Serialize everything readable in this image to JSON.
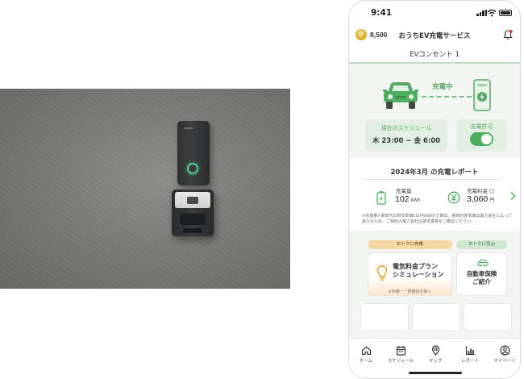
{
  "phone": {
    "status_bar": {
      "time": "9:41"
    },
    "header": {
      "coin_symbol": "P",
      "points": "8,500",
      "title": "おうちEV充電サービス",
      "bell_icon": "bell-icon"
    },
    "device_name": "EVコンセント 1",
    "charging": {
      "state_label": "充電中",
      "car_icon": "car-icon",
      "charger_icon": "charger-icon"
    },
    "schedule": {
      "label": "現在のスケジュール",
      "value": "木 23:00 ~ 金 6:00"
    },
    "permission": {
      "label": "充電許可",
      "enabled": true
    },
    "report": {
      "title": "2024年3月 の充電レポート",
      "amount_label": "充電量",
      "amount_value": "102",
      "amount_unit": "kWh",
      "fee_label": "充電料金",
      "fee_value": "3,060",
      "fee_unit": "円",
      "note": "※充電量×電気代の目安単価(31円/kWh)で算出。電気料金単価は電力会社によって異なるため、ご契約の電力会社の請求書等をご確認ください。"
    },
    "promos": [
      {
        "badge": "おトクに充電",
        "title_line1": "電気料金プラン",
        "title_line2": "シミュレーション",
        "footnote": "※沖縄・一部離島を除く"
      },
      {
        "badge": "おトクに安心",
        "title_line1": "自動車保険",
        "title_line2": "ご紹介"
      }
    ],
    "tabs": [
      {
        "label": "ホーム",
        "icon": "home-icon"
      },
      {
        "label": "スケジュール",
        "icon": "calendar-icon"
      },
      {
        "label": "マップ",
        "icon": "map-pin-icon"
      },
      {
        "label": "レポート",
        "icon": "chart-icon"
      },
      {
        "label": "マイページ",
        "icon": "user-icon"
      }
    ],
    "accent_color": "#4caf5f",
    "charging_color": "#55a766",
    "promo_orange": "#f5d9a4"
  }
}
